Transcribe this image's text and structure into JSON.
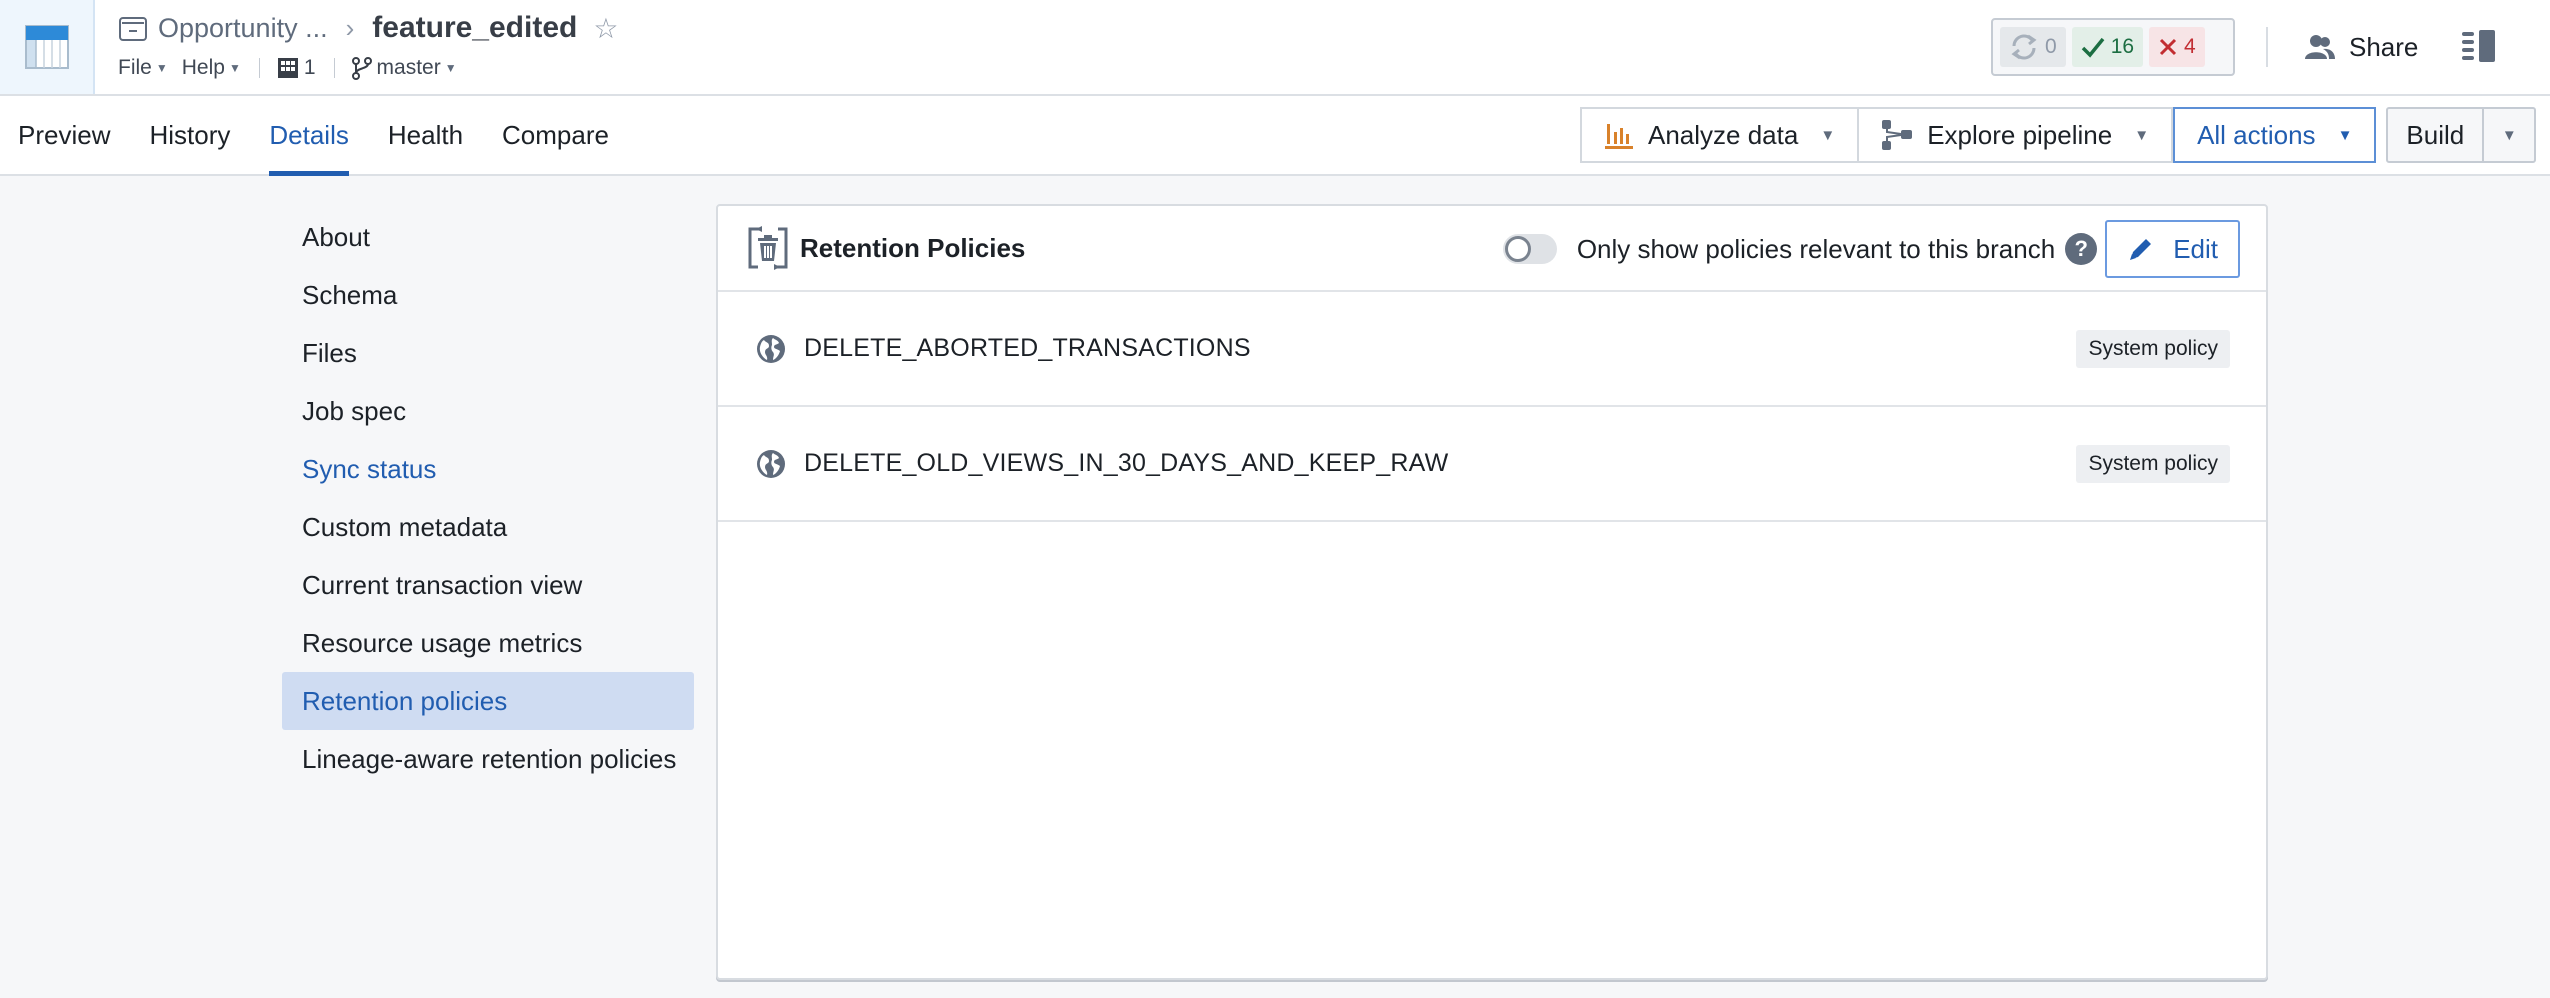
{
  "header": {
    "app_icon": "dataset-table-icon",
    "breadcrumb_parent": "Opportunity ...",
    "breadcrumb_current": "feature_edited",
    "menus": [
      {
        "label": "File"
      },
      {
        "label": "Help"
      }
    ],
    "builds_count": "1",
    "branch": "master",
    "status": {
      "pending": "0",
      "succeeded": "16",
      "failed": "4"
    },
    "share_label": "Share",
    "colors": {
      "accent": "#215db0",
      "success": "#1c6e42",
      "danger": "#c22d32"
    }
  },
  "tabs": [
    {
      "label": "Preview",
      "active": false
    },
    {
      "label": "History",
      "active": false
    },
    {
      "label": "Details",
      "active": true
    },
    {
      "label": "Health",
      "active": false
    },
    {
      "label": "Compare",
      "active": false
    }
  ],
  "actions": {
    "analyze": "Analyze data",
    "explore": "Explore pipeline",
    "all_actions": "All actions",
    "build": "Build"
  },
  "sidenav": [
    {
      "label": "About",
      "state": "normal"
    },
    {
      "label": "Schema",
      "state": "normal"
    },
    {
      "label": "Files",
      "state": "normal"
    },
    {
      "label": "Job spec",
      "state": "normal"
    },
    {
      "label": "Sync status",
      "state": "link"
    },
    {
      "label": "Custom metadata",
      "state": "normal"
    },
    {
      "label": "Current transaction view",
      "state": "normal"
    },
    {
      "label": "Resource usage metrics",
      "state": "normal"
    },
    {
      "label": "Retention policies",
      "state": "active"
    },
    {
      "label": "Lineage-aware retention policies",
      "state": "normal"
    }
  ],
  "panel": {
    "title": "Retention Policies",
    "toggle_label": "Only show policies relevant to this branch",
    "toggle_on": false,
    "edit_label": "Edit",
    "policies": [
      {
        "name": "DELETE_ABORTED_TRANSACTIONS",
        "tag": "System policy"
      },
      {
        "name": "DELETE_OLD_VIEWS_IN_30_DAYS_AND_KEEP_RAW",
        "tag": "System policy"
      }
    ]
  }
}
